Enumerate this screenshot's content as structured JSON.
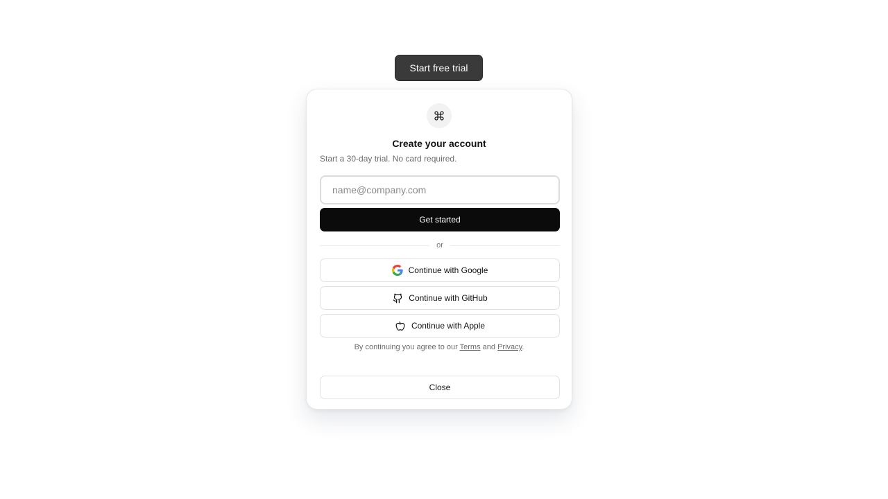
{
  "trigger": {
    "label": "Start free trial"
  },
  "dialog": {
    "title": "Create your account",
    "subtitle": "Start a 30-day trial. No card required.",
    "email_placeholder": "name@company.com",
    "email_value": "",
    "primary_label": "Get started",
    "divider_label": "or",
    "social": [
      {
        "label": "Continue with Google",
        "icon": "google-icon"
      },
      {
        "label": "Continue with GitHub",
        "icon": "github-icon"
      },
      {
        "label": "Continue with Apple",
        "icon": "apple-icon"
      }
    ],
    "legal": {
      "prefix": "By continuing you agree to our",
      "terms": "Terms",
      "and": "and",
      "privacy": "Privacy",
      "suffix": "."
    },
    "close_label": "Close"
  },
  "colors": {
    "primary_button": "#0b0b0b",
    "trigger_button": "#3a3a3a",
    "border": "#e2e2e2",
    "muted_text": "#6b6b6b"
  }
}
